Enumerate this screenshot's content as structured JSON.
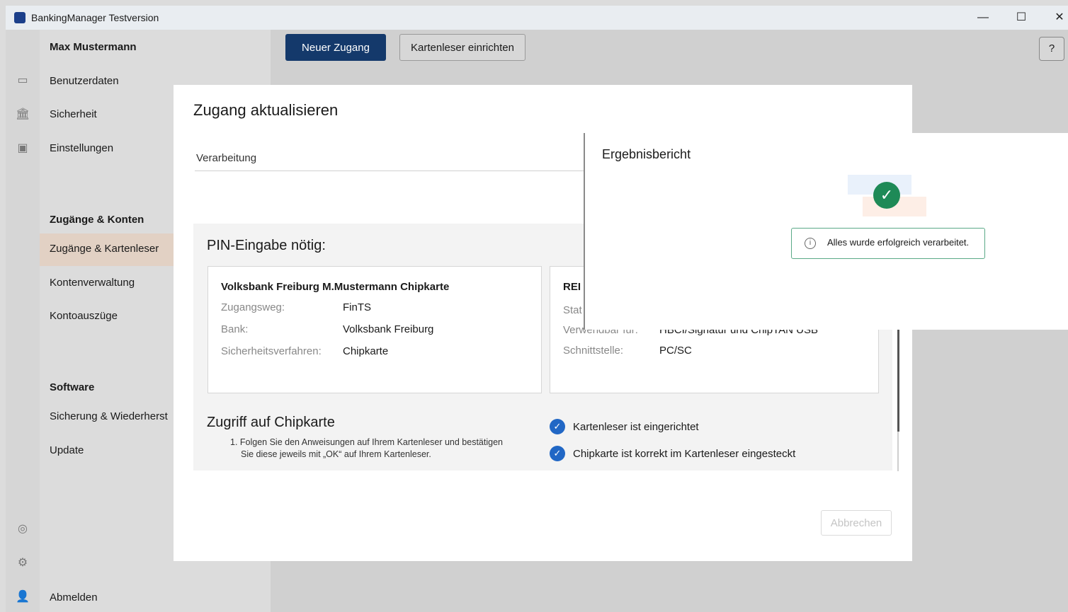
{
  "window": {
    "title": "BankingManager Testversion",
    "minimize": "—",
    "maximize": "☐",
    "close": "✕"
  },
  "sidebar": {
    "user": "Max Mustermann",
    "items": [
      {
        "label": "Benutzerdaten"
      },
      {
        "label": "Sicherheit"
      },
      {
        "label": "Einstellungen"
      }
    ],
    "section_accounts": "Zugänge & Konten",
    "accounts_items": [
      {
        "label": "Zugänge & Kartenleser"
      },
      {
        "label": "Kontenverwaltung"
      },
      {
        "label": "Kontoauszüge"
      }
    ],
    "section_software": "Software",
    "software_items": [
      {
        "label": "Sicherung & Wiederherst"
      },
      {
        "label": "Update"
      }
    ],
    "logout": "Abmelden"
  },
  "toolbar": {
    "new_access": "Neuer Zugang",
    "setup_reader": "Kartenleser einrichten",
    "help": "?"
  },
  "dialog": {
    "title": "Zugang aktualisieren",
    "tab": "Verarbeitung",
    "pin_heading": "PIN-Eingabe nötig:",
    "card1": {
      "title": "Volksbank Freiburg M.Mustermann Chipkarte",
      "rows": [
        {
          "label": "Zugangsweg:",
          "value": "FinTS"
        },
        {
          "label": "Bank:",
          "value": "Volksbank Freiburg"
        },
        {
          "label": "Sicherheitsverfahren:",
          "value": "Chipkarte"
        }
      ]
    },
    "card2": {
      "title_partial": "REI",
      "status_partial": "Stat",
      "usage_label_partial": "Verwendbar für:",
      "usage_value_partial": "HBCI/Signatur und ChipTAN USB",
      "interface_label": "Schnittstelle:",
      "interface_value": "PC/SC"
    },
    "chip_heading": "Zugriff auf Chipkarte",
    "instruction_line1": "1. Folgen Sie den Anweisungen auf Ihrem Kartenleser und bestätigen",
    "instruction_line2": "Sie diese jeweils mit „OK“ auf Ihrem Kartenleser.",
    "checks": [
      {
        "label": "Kartenleser ist eingerichtet"
      },
      {
        "label": "Chipkarte ist korrekt im Kartenleser eingesteckt"
      }
    ],
    "cancel": "Abbrechen"
  },
  "report": {
    "title": "Ergebnisbericht",
    "message": "Alles wurde erfolgreich verarbeitet.",
    "info_icon": "i",
    "success_icon": "✓"
  }
}
